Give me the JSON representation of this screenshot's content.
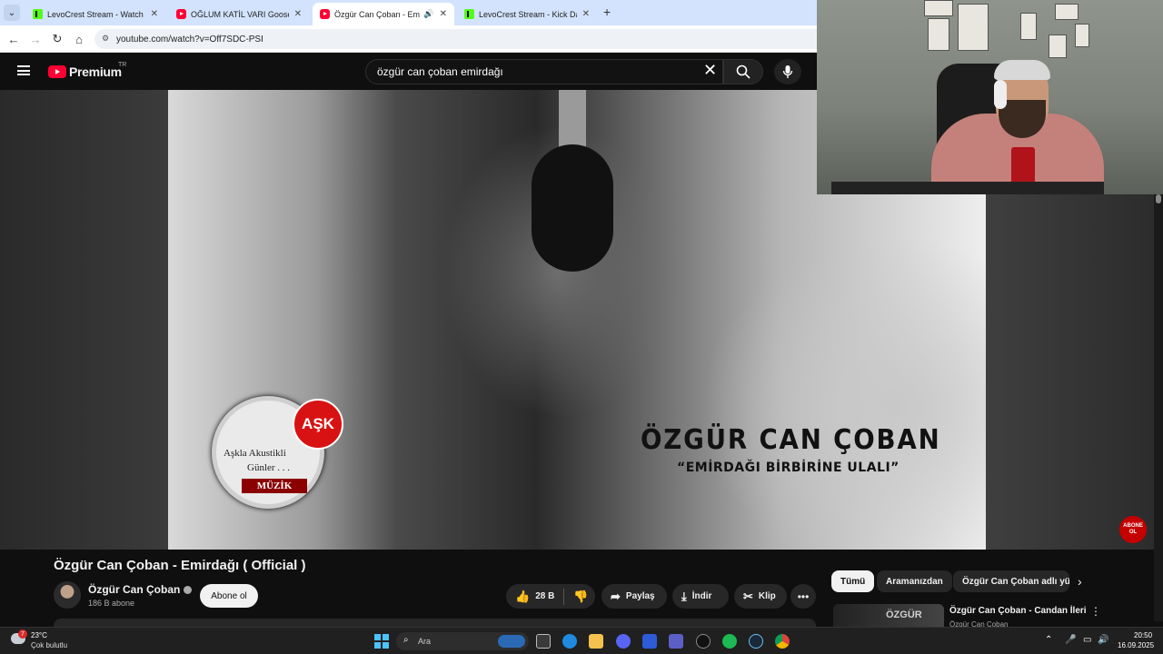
{
  "browser": {
    "tabs": [
      {
        "title": "LevoCrest Stream - Watch Live",
        "type": "kick",
        "active": false
      },
      {
        "title": "OĞLUM KATİL VARI Goose Goo",
        "type": "yt",
        "active": false
      },
      {
        "title": "Özgür Can Çoban - Emirdağ",
        "type": "yt",
        "active": true
      },
      {
        "title": "LevoCrest Stream - Kick Dashbo",
        "type": "kick",
        "active": false
      }
    ],
    "url": "youtube.com/watch?v=Off7SDC-PSI"
  },
  "youtube": {
    "logo_text": "Premium",
    "country_code": "TR",
    "search_query": "özgür can çoban emirdağı"
  },
  "video": {
    "overlay_title": "ÖZGÜR CAN ÇOBAN",
    "overlay_subtitle": "“EMİRDAĞI BİRBİRİNE ULALI”",
    "badge_ask": "AŞK",
    "badge_line1": "Aşkla Akustikli",
    "badge_line2": "Günler . . .",
    "badge_muzik": "MÜZİK",
    "subscribe_watermark": "ABONE OL",
    "title": "Özgür Can Çoban - Emirdağı ( Official )"
  },
  "channel": {
    "name": "Özgür Can Çoban",
    "subscribers": "186 B abone",
    "subscribe_label": "Abone ol"
  },
  "actions": {
    "likes": "28 B",
    "share": "Paylaş",
    "download": "İndir",
    "clip": "Klip"
  },
  "chips": [
    "Tümü",
    "Aramanızdan",
    "Özgür Can Çoban adlı yü"
  ],
  "recommendation": {
    "thumb_text": "ÖZGÜR",
    "title": "Özgür Can Çoban - Candan İleri",
    "channel": "Özgür Can Çoban"
  },
  "taskbar": {
    "weather_alert": "7",
    "temperature": "23°C",
    "weather": "Çok bulutlu",
    "search_placeholder": "Ara",
    "time": "20:50",
    "date": "16.09.2025"
  }
}
